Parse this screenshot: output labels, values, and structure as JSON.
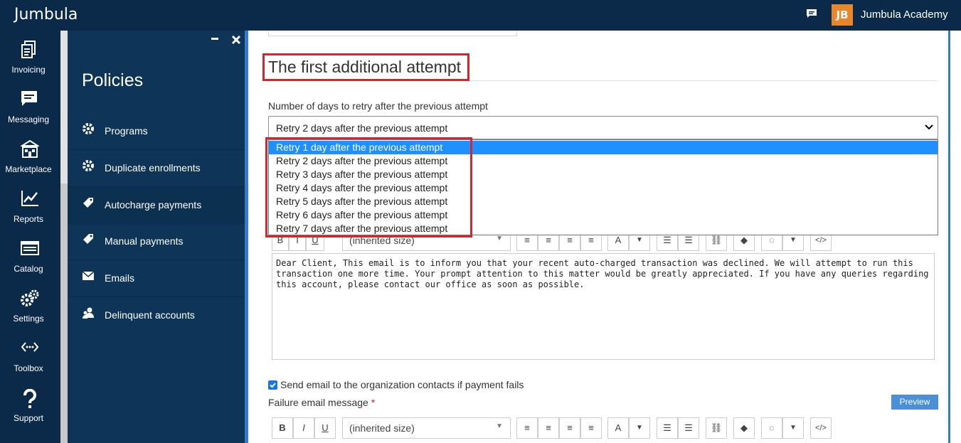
{
  "header": {
    "brand": "Jumbula",
    "org_logo_text": "JB",
    "org_name": "Jumbula Academy"
  },
  "rail": [
    {
      "label": "Invoicing",
      "icon": "invoice-icon"
    },
    {
      "label": "Messaging",
      "icon": "chat-icon"
    },
    {
      "label": "Marketplace",
      "icon": "store-icon"
    },
    {
      "label": "Reports",
      "icon": "chart-icon"
    },
    {
      "label": "Catalog",
      "icon": "catalog-icon"
    },
    {
      "label": "Settings",
      "icon": "gears-icon"
    },
    {
      "label": "Toolbox",
      "icon": "toolbox-icon"
    },
    {
      "label": "Support",
      "icon": "question-icon"
    }
  ],
  "policies": {
    "title": "Policies",
    "items": [
      {
        "label": "Programs",
        "icon": "gear-icon"
      },
      {
        "label": "Duplicate enrollments",
        "icon": "gear-icon"
      },
      {
        "label": "Autocharge payments",
        "icon": "tag-icon"
      },
      {
        "label": "Manual payments",
        "icon": "tag-icon"
      },
      {
        "label": "Emails",
        "icon": "envelope-icon"
      },
      {
        "label": "Delinquent accounts",
        "icon": "users-icon"
      }
    ]
  },
  "main": {
    "section_title": "The first additional attempt",
    "retry_label": "Number of days to retry after the previous attempt",
    "retry_selected": "Retry 2 days after the previous attempt",
    "retry_options": [
      "Retry 1 day after the previous attempt",
      "Retry 2 days after the previous attempt",
      "Retry 3 days after the previous attempt",
      "Retry 4 days after the previous attempt",
      "Retry 5 days after the previous attempt",
      "Retry 6 days after the previous attempt",
      "Retry 7 days after the previous attempt"
    ],
    "highlighted_option": "Retry 1 day after the previous attempt",
    "toolbar": {
      "bold": "B",
      "italic": "I",
      "underline": "U",
      "font_size": "(inherited size)",
      "text_color": "A"
    },
    "email_body": "Dear Client, This email is to inform you that your recent auto-charged transaction was declined. We will attempt to run this transaction one more time. Your prompt attention to this matter would be greatly appreciated. If you have any queries regarding this account, please contact our office as soon as possible.",
    "send_email_label": "Send email to the organization contacts if payment fails",
    "send_email_checked": true,
    "failure_label": "Failure email message",
    "required_mark": "*",
    "preview_label": "Preview"
  },
  "colors": {
    "nav_bg": "#0b2a4a",
    "panel_bg": "#0e3558",
    "accent": "#2f7bd6",
    "highlight_red": "#d9232d",
    "selected_option": "#1e90ff",
    "logo_orange": "#e8862a"
  }
}
